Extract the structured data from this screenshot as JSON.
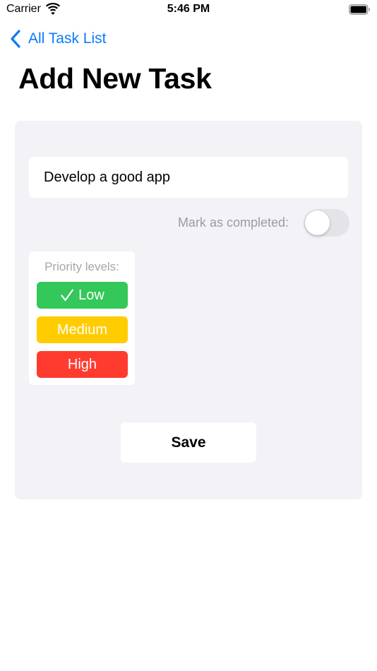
{
  "status_bar": {
    "carrier": "Carrier",
    "time": "5:46 PM",
    "wifi_icon": "wifi-icon",
    "battery_icon": "battery-icon"
  },
  "nav": {
    "back_label": "All Task List",
    "back_icon": "chevron-left-icon"
  },
  "page": {
    "title": "Add New Task"
  },
  "form": {
    "task_name_value": "Develop a good app",
    "completed_label": "Mark as completed:",
    "completed": false,
    "priority": {
      "title": "Priority levels:",
      "options": [
        {
          "label": "Low",
          "color": "#34c759",
          "selected": true
        },
        {
          "label": "Medium",
          "color": "#ffcc00",
          "selected": false
        },
        {
          "label": "High",
          "color": "#ff3b30",
          "selected": false
        }
      ]
    },
    "save_label": "Save"
  },
  "colors": {
    "accent": "#0a7aff",
    "card_background": "#f2f2f7",
    "toggle_off": "#e3e3e8"
  }
}
